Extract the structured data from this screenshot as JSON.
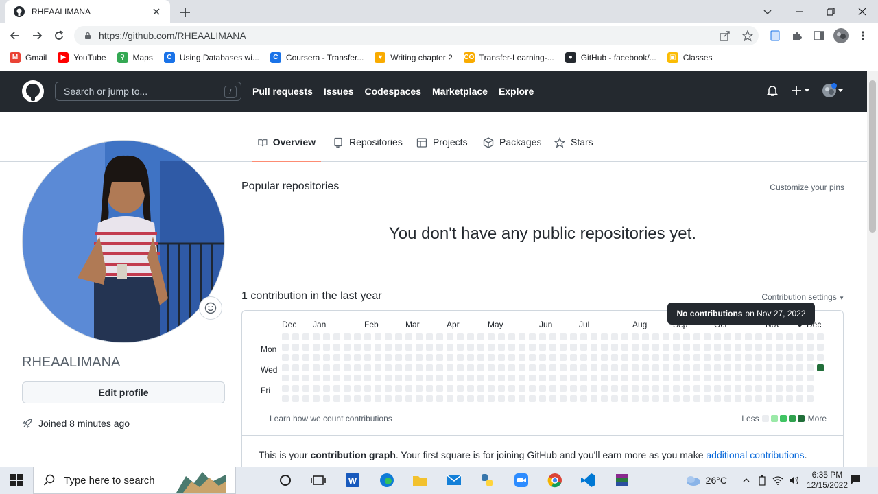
{
  "browser": {
    "tab_title": "RHEAALIMANA",
    "url": "https://github.com/RHEAALIMANA",
    "bookmarks": [
      {
        "label": "Gmail",
        "color": "#ea4335",
        "glyph": "M"
      },
      {
        "label": "YouTube",
        "color": "#ff0000",
        "glyph": "▶"
      },
      {
        "label": "Maps",
        "color": "#34a853",
        "glyph": "⚲"
      },
      {
        "label": "Using Databases wi...",
        "color": "#1a73e8",
        "glyph": "C"
      },
      {
        "label": "Coursera - Transfer...",
        "color": "#1a73e8",
        "glyph": "C"
      },
      {
        "label": "Writing chapter 2",
        "color": "#f9ab00",
        "glyph": "♥"
      },
      {
        "label": "Transfer-Learning-...",
        "color": "#f9ab00",
        "glyph": "CO"
      },
      {
        "label": "GitHub - facebook/...",
        "color": "#24292f",
        "glyph": "●"
      },
      {
        "label": "Classes",
        "color": "#fbbc04",
        "glyph": "▣"
      }
    ]
  },
  "github": {
    "search_placeholder": "Search or jump to...",
    "slash_key": "/",
    "nav": [
      "Pull requests",
      "Issues",
      "Codespaces",
      "Marketplace",
      "Explore"
    ],
    "tabs": [
      "Overview",
      "Repositories",
      "Projects",
      "Packages",
      "Stars"
    ],
    "username": "RHEAALIMANA",
    "edit_profile": "Edit profile",
    "joined": "Joined 8 minutes ago",
    "popular_title": "Popular repositories",
    "customize_pins": "Customize your pins",
    "empty_repos": "You don't have any public repositories yet.",
    "contrib_title": "1 contribution in the last year",
    "contrib_settings": "Contribution settings",
    "months": [
      "Dec",
      "Jan",
      "Feb",
      "Mar",
      "Apr",
      "May",
      "Jun",
      "Jul",
      "Aug",
      "Sep",
      "Oct",
      "Nov",
      "Dec"
    ],
    "day_labels": [
      "Mon",
      "Wed",
      "Fri"
    ],
    "learn_link": "Learn how we count contributions",
    "legend_less": "Less",
    "legend_more": "More",
    "legend_colors": [
      "#ebedf0",
      "#9be9a8",
      "#40c463",
      "#30a14e",
      "#216e39"
    ],
    "tooltip_bold": "No contributions",
    "tooltip_rest": "on Nov 27, 2022",
    "explain_a": "This is your ",
    "explain_b": "contribution graph",
    "explain_c": ". Your first square is for joining GitHub and you'll earn more as you make ",
    "explain_link": "additional contributions",
    "explain_d": "."
  },
  "taskbar": {
    "search_placeholder": "Type here to search",
    "weather": "26°C",
    "time": "6:35 PM",
    "date": "12/15/2022"
  }
}
